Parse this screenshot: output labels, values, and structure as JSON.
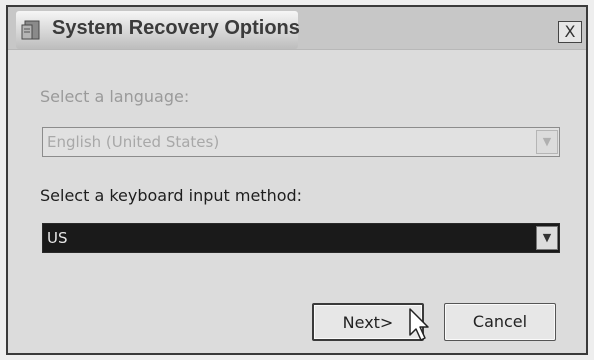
{
  "window": {
    "title": "System Recovery Options",
    "close_label": "X",
    "app_icon": "recovery-app-icon"
  },
  "language": {
    "label": "Select a language:",
    "value": "English (United States)",
    "enabled": false
  },
  "keyboard": {
    "label": "Select a keyboard input method:",
    "value": "US",
    "selected": true
  },
  "buttons": {
    "next": "Next>",
    "cancel": "Cancel"
  },
  "colors": {
    "dialog_bg": "#dcdcdc",
    "selected_combo_bg": "#1a1a1a",
    "disabled_text": "#a8a8a8"
  },
  "icons": {
    "dropdown": "chevron-down-icon",
    "pointer": "mouse-pointer-icon"
  }
}
